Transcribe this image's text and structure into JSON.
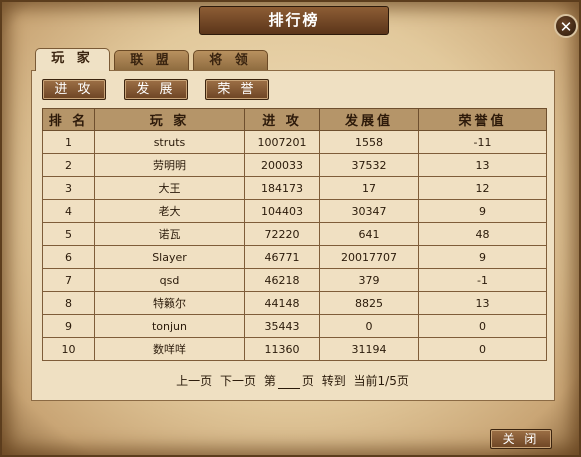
{
  "window": {
    "title": "排行榜",
    "close_icon": "close-icon"
  },
  "tabs": [
    {
      "label": "玩 家",
      "active": true
    },
    {
      "label": "联 盟",
      "active": false
    },
    {
      "label": "将 领",
      "active": false
    }
  ],
  "sub_buttons": [
    "进 攻",
    "发 展",
    "荣 誉"
  ],
  "table": {
    "headers": [
      "排 名",
      "玩 家",
      "进 攻",
      "发展值",
      "荣誉值"
    ],
    "rows": [
      [
        "1",
        "struts",
        "1007201",
        "1558",
        "-11"
      ],
      [
        "2",
        "劳明明",
        "200033",
        "37532",
        "13"
      ],
      [
        "3",
        "大王",
        "184173",
        "17",
        "12"
      ],
      [
        "4",
        "老大",
        "104403",
        "30347",
        "9"
      ],
      [
        "5",
        "诺瓦",
        "72220",
        "641",
        "48"
      ],
      [
        "6",
        "Slayer",
        "46771",
        "20017707",
        "9"
      ],
      [
        "7",
        "qsd",
        "46218",
        "379",
        "-1"
      ],
      [
        "8",
        "特籁尔",
        "44148",
        "8825",
        "13"
      ],
      [
        "9",
        "tonjun",
        "35443",
        "0",
        "0"
      ],
      [
        "10",
        "数咩咩",
        "11360",
        "31194",
        "0"
      ]
    ]
  },
  "pager": {
    "prev": "上一页",
    "next": "下一页",
    "page_prefix": "第",
    "page_value": "",
    "page_suffix": "页",
    "goto": "转到",
    "current": "当前1/5页"
  },
  "footer": {
    "close_label": "关 闭"
  }
}
